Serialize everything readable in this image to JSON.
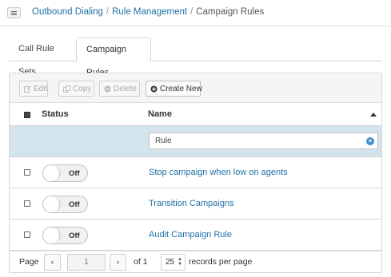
{
  "breadcrumb": {
    "items": [
      "Outbound Dialing",
      "Rule Management"
    ],
    "separator": "/",
    "current": "Campaign Rules"
  },
  "tabs": [
    {
      "label": "Call Rule Sets",
      "active": false
    },
    {
      "label": "Campaign Rules",
      "active": true
    }
  ],
  "toolbar": {
    "edit_label": "Edit",
    "copy_label": "Copy",
    "delete_label": "Delete",
    "create_label": "Create New"
  },
  "table": {
    "columns": {
      "status": "Status",
      "name": "Name"
    },
    "sort_direction": "ascending",
    "filter": {
      "value": "Rule"
    },
    "rows": [
      {
        "status": "Off",
        "name": "Stop campaign when low on agents"
      },
      {
        "status": "Off",
        "name": "Transition Campaigns"
      },
      {
        "status": "Off",
        "name": "Audit Campaign Rule"
      }
    ]
  },
  "pager": {
    "page_label": "Page",
    "current_page": "1",
    "of_label": "of 1",
    "page_size": "25",
    "records_label": "records per page"
  },
  "colors": {
    "link": "#1f6fa7",
    "filter_row": "#d4e4ec",
    "clear_icon": "#3b8fd0"
  }
}
